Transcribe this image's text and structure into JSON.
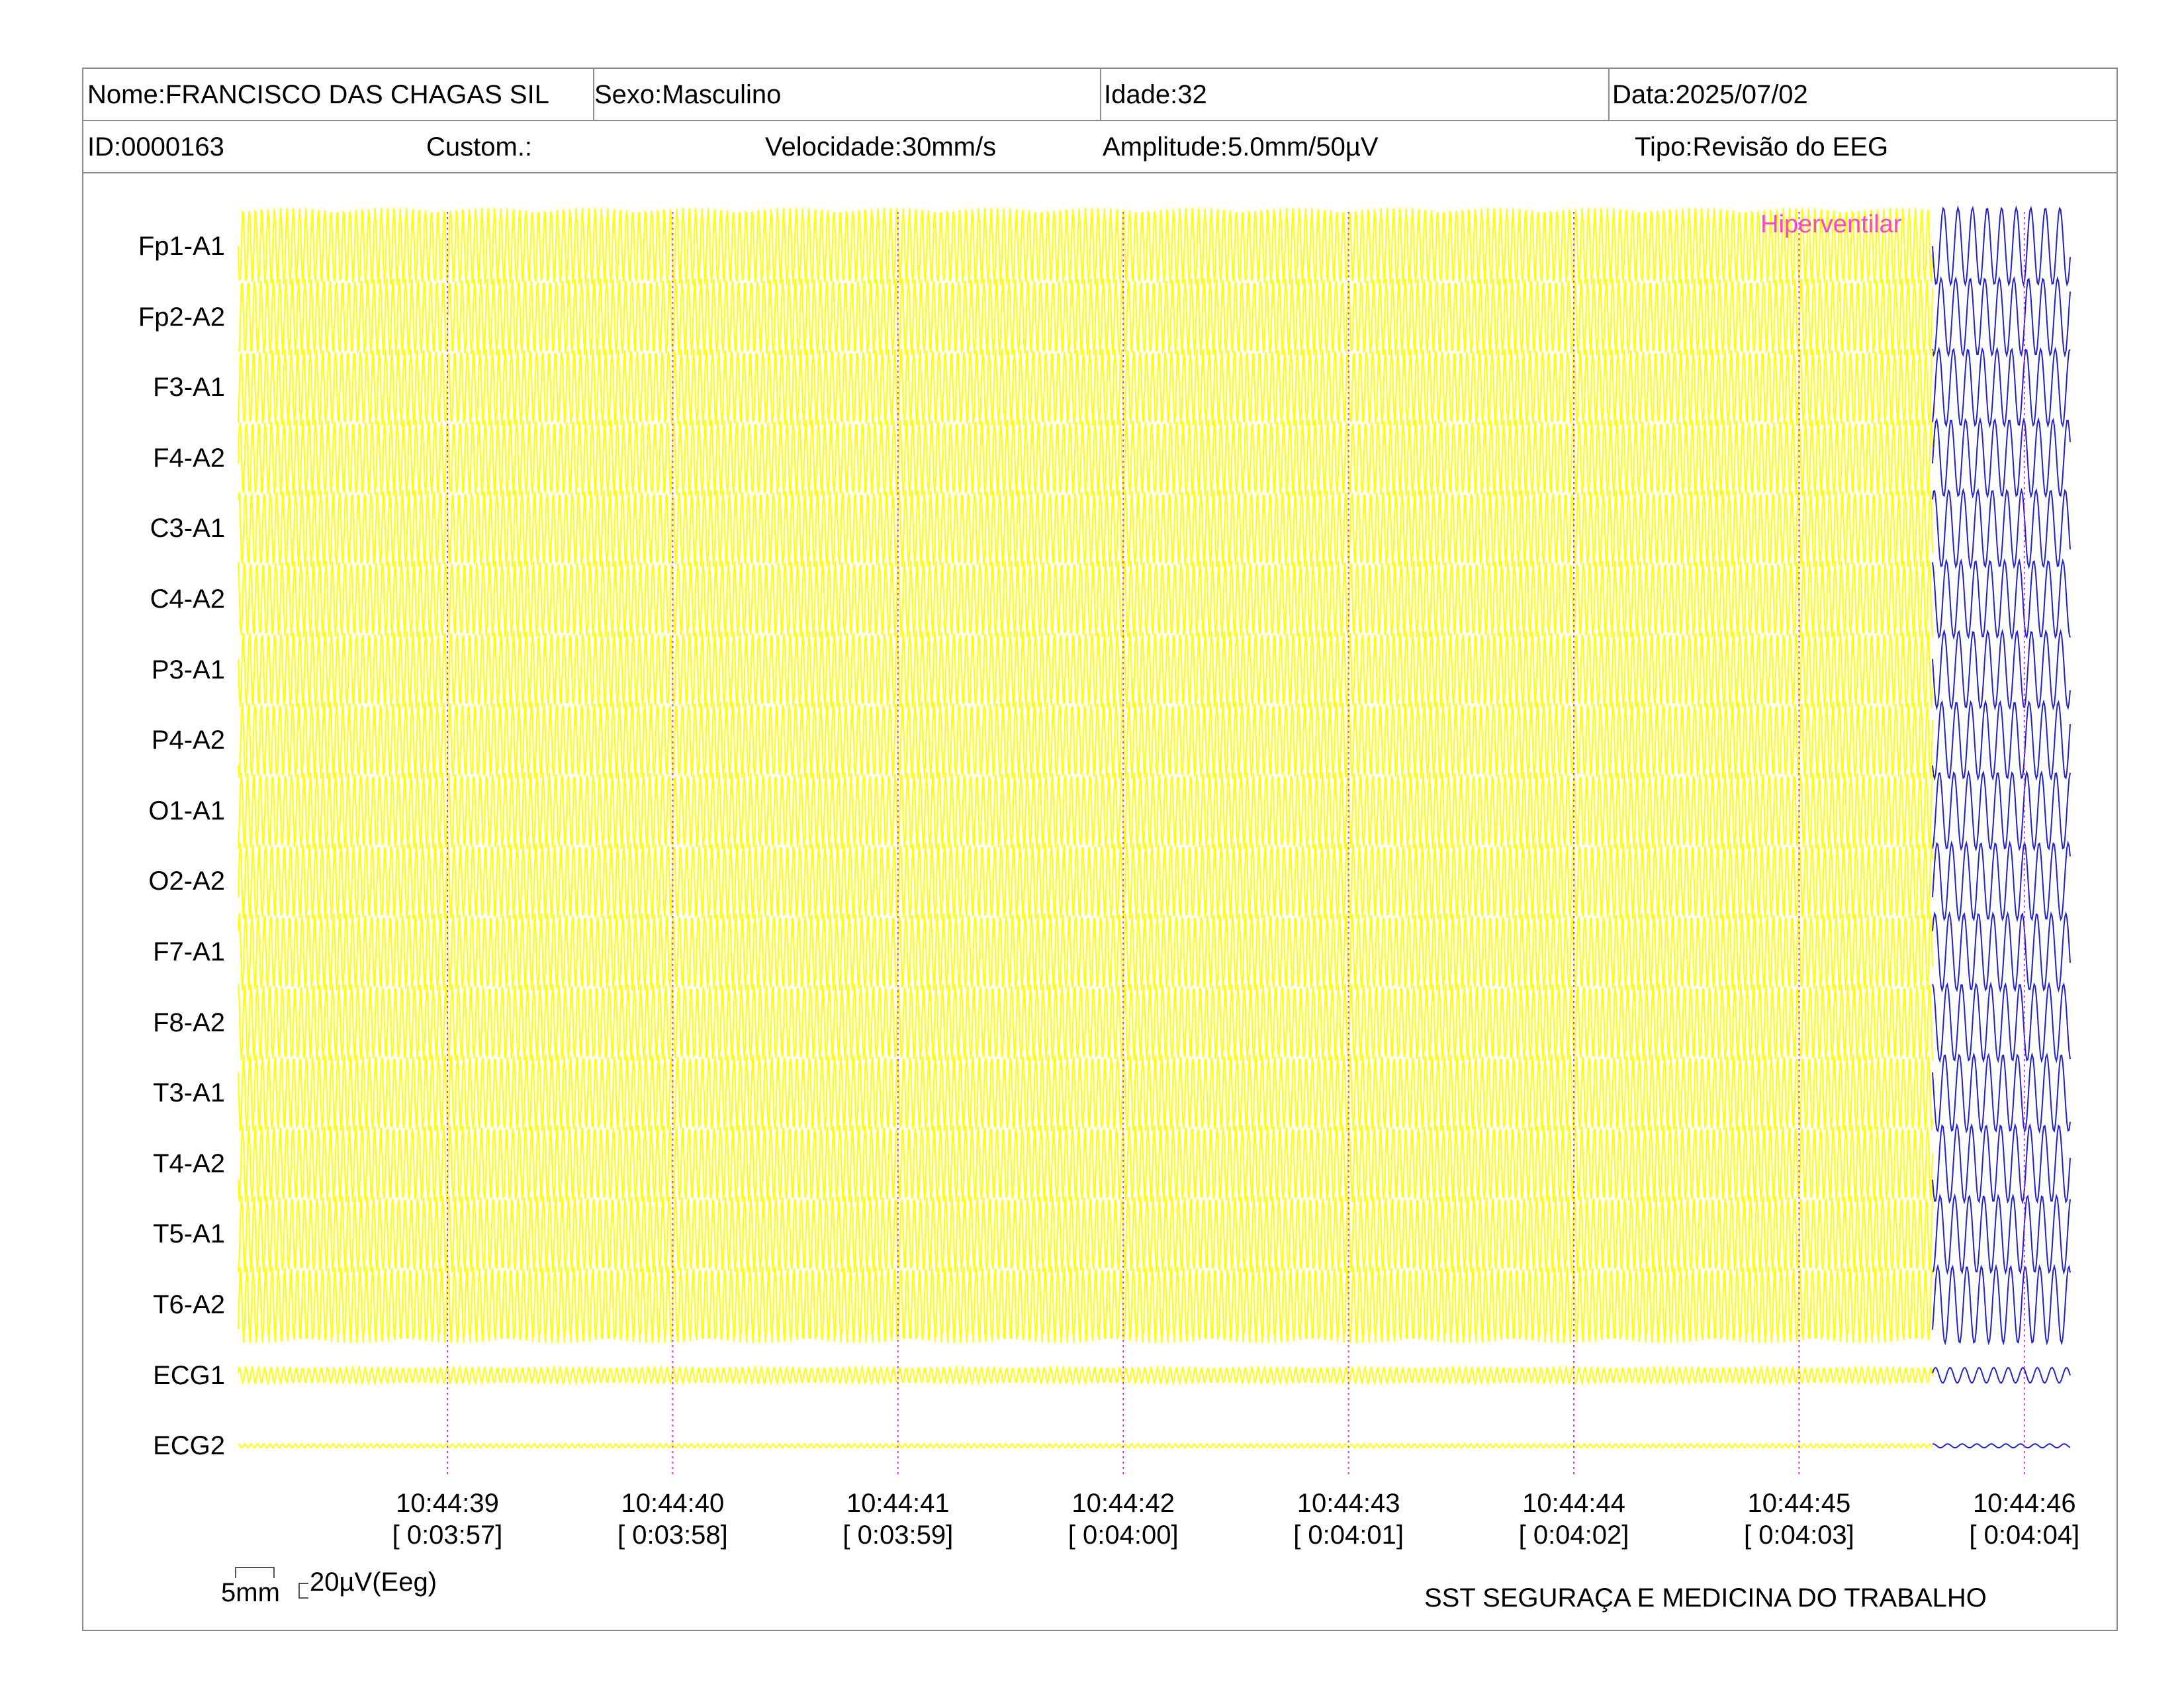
{
  "header": {
    "name": "Nome:FRANCISCO DAS CHAGAS SIL",
    "sex": "Sexo:Masculino",
    "age": "Idade:32",
    "date": "Data:2025/07/02",
    "id": "ID:0000163",
    "custom": "Custom.:",
    "speed": "Velocidade:30mm/s",
    "amplitude": "Amplitude:5.0mm/50µV",
    "type": "Tipo:Revisão do EEG"
  },
  "channels": [
    {
      "label": "Fp1-A1",
      "amp": 1.0
    },
    {
      "label": "Fp2-A2",
      "amp": 1.0
    },
    {
      "label": "F3-A1",
      "amp": 1.0
    },
    {
      "label": "F4-A2",
      "amp": 1.0
    },
    {
      "label": "C3-A1",
      "amp": 1.0
    },
    {
      "label": "C4-A2",
      "amp": 1.0
    },
    {
      "label": "P3-A1",
      "amp": 1.0
    },
    {
      "label": "P4-A2",
      "amp": 1.0
    },
    {
      "label": "O1-A1",
      "amp": 1.0
    },
    {
      "label": "O2-A2",
      "amp": 1.0
    },
    {
      "label": "F7-A1",
      "amp": 1.0
    },
    {
      "label": "F8-A2",
      "amp": 1.0
    },
    {
      "label": "T3-A1",
      "amp": 1.0
    },
    {
      "label": "T4-A2",
      "amp": 1.0
    },
    {
      "label": "T5-A1",
      "amp": 1.0
    },
    {
      "label": "T6-A2",
      "amp": 1.0
    },
    {
      "label": "ECG1",
      "amp": 0.2
    },
    {
      "label": "ECG2",
      "amp": 0.05
    }
  ],
  "time_marks": [
    {
      "clock": "10:44:39",
      "elapsed": "[ 0:03:57]"
    },
    {
      "clock": "10:44:40",
      "elapsed": "[ 0:03:58]"
    },
    {
      "clock": "10:44:41",
      "elapsed": "[ 0:03:59]"
    },
    {
      "clock": "10:44:42",
      "elapsed": "[ 0:04:00]"
    },
    {
      "clock": "10:44:43",
      "elapsed": "[ 0:04:01]"
    },
    {
      "clock": "10:44:44",
      "elapsed": "[ 0:04:02]"
    },
    {
      "clock": "10:44:45",
      "elapsed": "[ 0:04:03]"
    },
    {
      "clock": "10:44:46",
      "elapsed": "[ 0:04:04]"
    }
  ],
  "event_marker": "Hiperventilar",
  "colors": {
    "trace_before": "#ffff00",
    "trace_after": "#2222cc",
    "time_line": "#dd33dd",
    "marker": "#ff44cc",
    "border": "#8c8c8c"
  },
  "scale": {
    "mm_label": "5mm",
    "uv_label": "20µV(Eeg)"
  },
  "footer": {
    "organization": "SST SEGURAÇA E MEDICINA DO TRABALHO"
  }
}
